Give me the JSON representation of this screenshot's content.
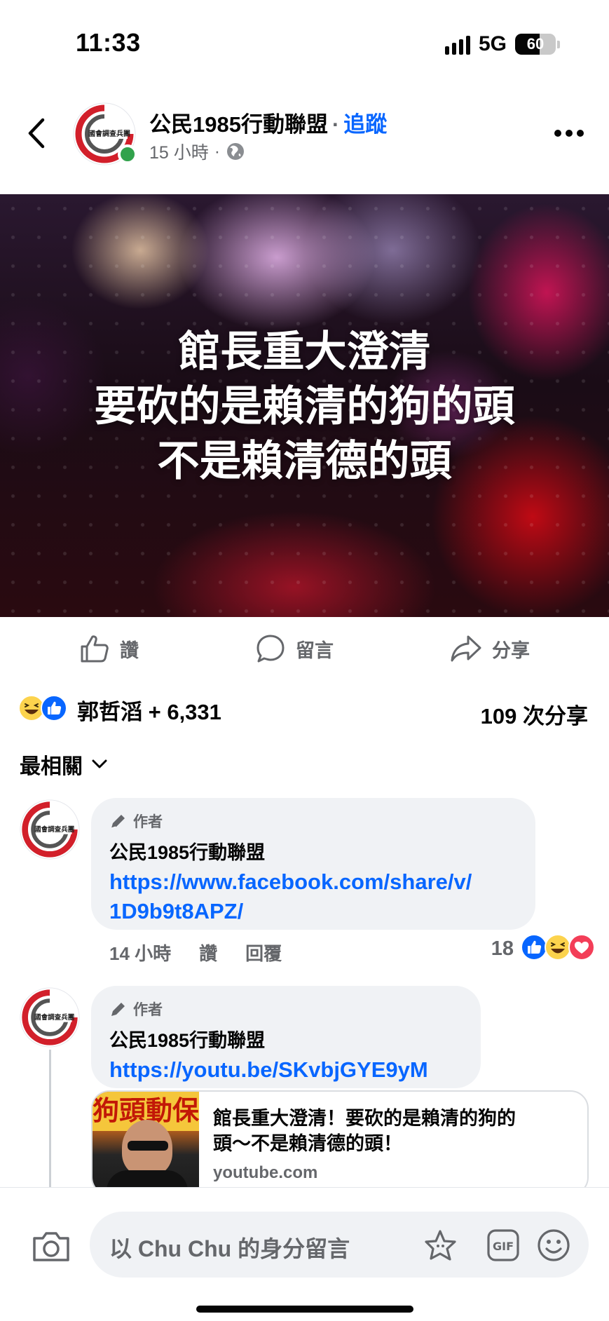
{
  "status_bar": {
    "time": "11:33",
    "network": "5G",
    "battery_percent": "60",
    "battery_level": 0.6
  },
  "header": {
    "page_name": "公民1985行動聯盟",
    "separator": "·",
    "follow_label": "追蹤",
    "time_ago": "15 小時",
    "meta_separator": "·",
    "avatar_logo_text": "國會調查兵團",
    "icons": {
      "back": "chevron-left-icon",
      "privacy": "globe-icon",
      "more": "more-horizontal-icon"
    }
  },
  "post": {
    "image_lines": [
      "館長重大澄清",
      "要砍的是賴清的狗的頭",
      "不是賴清德的頭"
    ]
  },
  "actions": {
    "like": "讚",
    "comment": "留言",
    "share": "分享"
  },
  "summary": {
    "reactions_text": "郭哲滔 + 6,331",
    "reaction_icons": [
      "haha-icon",
      "like-icon"
    ],
    "shares_text": "109 次分享"
  },
  "sort": {
    "label": "最相關"
  },
  "comments": [
    {
      "badge": "作者",
      "name": "公民1985行動聯盟",
      "link_lines": [
        "https://www.facebook.com/share/v/",
        "1D9b9t8APZ/"
      ],
      "time": "14 小時",
      "like_label": "讚",
      "reply_label": "回覆",
      "reaction_count": "18",
      "reaction_icons": [
        "like-icon",
        "haha-icon",
        "love-icon"
      ]
    },
    {
      "badge": "作者",
      "name": "公民1985行動聯盟",
      "link_lines": [
        "https://youtu.be/SKvbjGYE9yM"
      ],
      "preview": {
        "title_lines": [
          "館長重大澄清！要砍的是賴清的狗的",
          "頭～不是賴清德的頭！"
        ],
        "domain": "youtube.com",
        "thumb_text": "狗頭動保"
      }
    }
  ],
  "composer": {
    "placeholder": "以 Chu Chu 的身分留言",
    "gif_label": "GIF",
    "icons": [
      "camera-icon",
      "avatar-sticker-icon",
      "gif-icon",
      "emoji-icon"
    ]
  },
  "colors": {
    "accent": "#0866ff",
    "secondary_text": "#65676b",
    "bubble": "#f0f2f5",
    "online": "#31a24c"
  }
}
